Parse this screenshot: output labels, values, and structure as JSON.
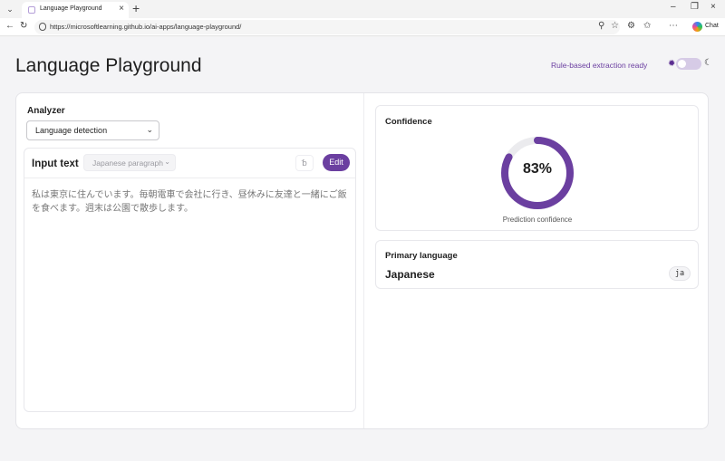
{
  "browser": {
    "tab_title": "Language Playground",
    "url": "https://microsoftlearning.github.io/ai-apps/language-playground/",
    "chat_label": "Chat"
  },
  "header": {
    "title": "Language Playground",
    "status": "Rule-based extraction ready"
  },
  "analyzer": {
    "label": "Analyzer",
    "selected": "Language detection"
  },
  "input": {
    "title": "Input text",
    "sample_selected": "Japanese paragraph",
    "clear_label": "␢",
    "edit_label": "Edit",
    "text": "私は東京に住んでいます。毎朝電車で会社に行き、昼休みに友達と一緒にご飯を食べます。週末は公園で散歩します。"
  },
  "confidence": {
    "title": "Confidence",
    "value_percent": 83,
    "value_label": "83%",
    "caption": "Prediction confidence"
  },
  "primary_language": {
    "title": "Primary language",
    "name": "Japanese",
    "code": "ja"
  },
  "colors": {
    "accent": "#6b3fa0",
    "gauge_track": "#ebebee"
  },
  "icons": {
    "menu": "chevron-down-icon",
    "favicon": "page-icon",
    "close": "close-icon",
    "new_tab": "plus-icon",
    "back": "arrow-left-icon",
    "reload": "reload-icon",
    "lock": "lock-icon",
    "zoom": "zoom-icon",
    "star": "star-icon",
    "extensions": "extensions-icon",
    "favorites": "favorites-icon",
    "theme_light": "sun-icon",
    "theme_dark": "moon-icon"
  }
}
